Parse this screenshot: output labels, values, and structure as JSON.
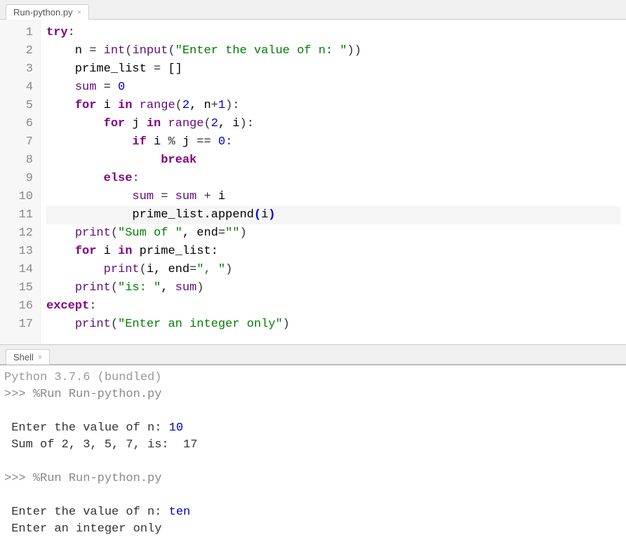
{
  "editor_tab": {
    "label": "Run-python.py"
  },
  "shell_tab": {
    "label": "Shell"
  },
  "code": {
    "line_numbers": [
      "1",
      "2",
      "3",
      "4",
      "5",
      "6",
      "7",
      "8",
      "9",
      "10",
      "11",
      "12",
      "13",
      "14",
      "15",
      "16",
      "17"
    ],
    "lines": [
      [
        {
          "t": "try",
          "c": "kw"
        },
        {
          "t": ":",
          "c": "op"
        }
      ],
      [
        {
          "t": "    n ",
          "c": ""
        },
        {
          "t": "=",
          "c": "op"
        },
        {
          "t": " ",
          "c": ""
        },
        {
          "t": "int",
          "c": "builtin"
        },
        {
          "t": "(",
          "c": "punc-paren"
        },
        {
          "t": "input",
          "c": "builtin"
        },
        {
          "t": "(",
          "c": "punc-paren"
        },
        {
          "t": "\"Enter the value of n: \"",
          "c": "str"
        },
        {
          "t": "))",
          "c": "punc-paren"
        }
      ],
      [
        {
          "t": "    prime_list ",
          "c": ""
        },
        {
          "t": "=",
          "c": "op"
        },
        {
          "t": " []",
          "c": ""
        }
      ],
      [
        {
          "t": "    ",
          "c": ""
        },
        {
          "t": "sum",
          "c": "builtin"
        },
        {
          "t": " ",
          "c": ""
        },
        {
          "t": "=",
          "c": "op"
        },
        {
          "t": " ",
          "c": ""
        },
        {
          "t": "0",
          "c": "num"
        }
      ],
      [
        {
          "t": "    ",
          "c": ""
        },
        {
          "t": "for",
          "c": "kw"
        },
        {
          "t": " i ",
          "c": ""
        },
        {
          "t": "in",
          "c": "kw"
        },
        {
          "t": " ",
          "c": ""
        },
        {
          "t": "range",
          "c": "builtin"
        },
        {
          "t": "(",
          "c": "punc-paren"
        },
        {
          "t": "2",
          "c": "num"
        },
        {
          "t": ", n",
          "c": ""
        },
        {
          "t": "+",
          "c": "op"
        },
        {
          "t": "1",
          "c": "num"
        },
        {
          "t": ")",
          "c": "punc-paren"
        },
        {
          "t": ":",
          "c": "op"
        }
      ],
      [
        {
          "t": "        ",
          "c": ""
        },
        {
          "t": "for",
          "c": "kw"
        },
        {
          "t": " j ",
          "c": ""
        },
        {
          "t": "in",
          "c": "kw"
        },
        {
          "t": " ",
          "c": ""
        },
        {
          "t": "range",
          "c": "builtin"
        },
        {
          "t": "(",
          "c": "punc-paren"
        },
        {
          "t": "2",
          "c": "num"
        },
        {
          "t": ", i",
          "c": ""
        },
        {
          "t": ")",
          "c": "punc-paren"
        },
        {
          "t": ":",
          "c": "op"
        }
      ],
      [
        {
          "t": "            ",
          "c": ""
        },
        {
          "t": "if",
          "c": "kw"
        },
        {
          "t": " i ",
          "c": ""
        },
        {
          "t": "%",
          "c": "op"
        },
        {
          "t": " j ",
          "c": ""
        },
        {
          "t": "==",
          "c": "op"
        },
        {
          "t": " ",
          "c": ""
        },
        {
          "t": "0",
          "c": "num"
        },
        {
          "t": ":",
          "c": "op"
        }
      ],
      [
        {
          "t": "                ",
          "c": ""
        },
        {
          "t": "break",
          "c": "kw"
        }
      ],
      [
        {
          "t": "        ",
          "c": ""
        },
        {
          "t": "else",
          "c": "kw"
        },
        {
          "t": ":",
          "c": "op"
        }
      ],
      [
        {
          "t": "            ",
          "c": ""
        },
        {
          "t": "sum",
          "c": "builtin"
        },
        {
          "t": " ",
          "c": ""
        },
        {
          "t": "=",
          "c": "op"
        },
        {
          "t": " ",
          "c": ""
        },
        {
          "t": "sum",
          "c": "builtin"
        },
        {
          "t": " ",
          "c": ""
        },
        {
          "t": "+",
          "c": "op"
        },
        {
          "t": " i",
          "c": ""
        }
      ],
      [
        {
          "t": "            prime_list.append",
          "c": ""
        },
        {
          "t": "(",
          "c": "paren-match"
        },
        {
          "t": "i",
          "c": ""
        },
        {
          "t": ")",
          "c": "paren-match"
        }
      ],
      [
        {
          "t": "    ",
          "c": ""
        },
        {
          "t": "print",
          "c": "builtin"
        },
        {
          "t": "(",
          "c": "punc-paren"
        },
        {
          "t": "\"Sum of \"",
          "c": "str"
        },
        {
          "t": ", end",
          "c": ""
        },
        {
          "t": "=",
          "c": "op"
        },
        {
          "t": "\"\"",
          "c": "str"
        },
        {
          "t": ")",
          "c": "punc-paren"
        }
      ],
      [
        {
          "t": "    ",
          "c": ""
        },
        {
          "t": "for",
          "c": "kw"
        },
        {
          "t": " i ",
          "c": ""
        },
        {
          "t": "in",
          "c": "kw"
        },
        {
          "t": " prime_list:",
          "c": ""
        }
      ],
      [
        {
          "t": "        ",
          "c": ""
        },
        {
          "t": "print",
          "c": "builtin"
        },
        {
          "t": "(",
          "c": "punc-paren"
        },
        {
          "t": "i, end",
          "c": ""
        },
        {
          "t": "=",
          "c": "op"
        },
        {
          "t": "\", \"",
          "c": "str"
        },
        {
          "t": ")",
          "c": "punc-paren"
        }
      ],
      [
        {
          "t": "    ",
          "c": ""
        },
        {
          "t": "print",
          "c": "builtin"
        },
        {
          "t": "(",
          "c": "punc-paren"
        },
        {
          "t": "\"is: \"",
          "c": "str"
        },
        {
          "t": ", ",
          "c": ""
        },
        {
          "t": "sum",
          "c": "builtin"
        },
        {
          "t": ")",
          "c": "punc-paren"
        }
      ],
      [
        {
          "t": "except",
          "c": "kw"
        },
        {
          "t": ":",
          "c": "op"
        }
      ],
      [
        {
          "t": "    ",
          "c": ""
        },
        {
          "t": "print",
          "c": "builtin"
        },
        {
          "t": "(",
          "c": "punc-paren"
        },
        {
          "t": "\"Enter an integer only\"",
          "c": "str"
        },
        {
          "t": ")",
          "c": "punc-paren"
        }
      ]
    ],
    "highlighted_line_index": 10
  },
  "shell": {
    "header": "Python 3.7.6 (bundled)",
    "prompt": ">>>",
    "run1": {
      "cmd": "%Run Run-python.py",
      "prompt_text": " Enter the value of n: ",
      "input": "10",
      "output": " Sum of 2, 3, 5, 7, is:  17"
    },
    "run2": {
      "cmd": "%Run Run-python.py",
      "prompt_text": " Enter the value of n: ",
      "input": "ten",
      "output": " Enter an integer only"
    }
  }
}
